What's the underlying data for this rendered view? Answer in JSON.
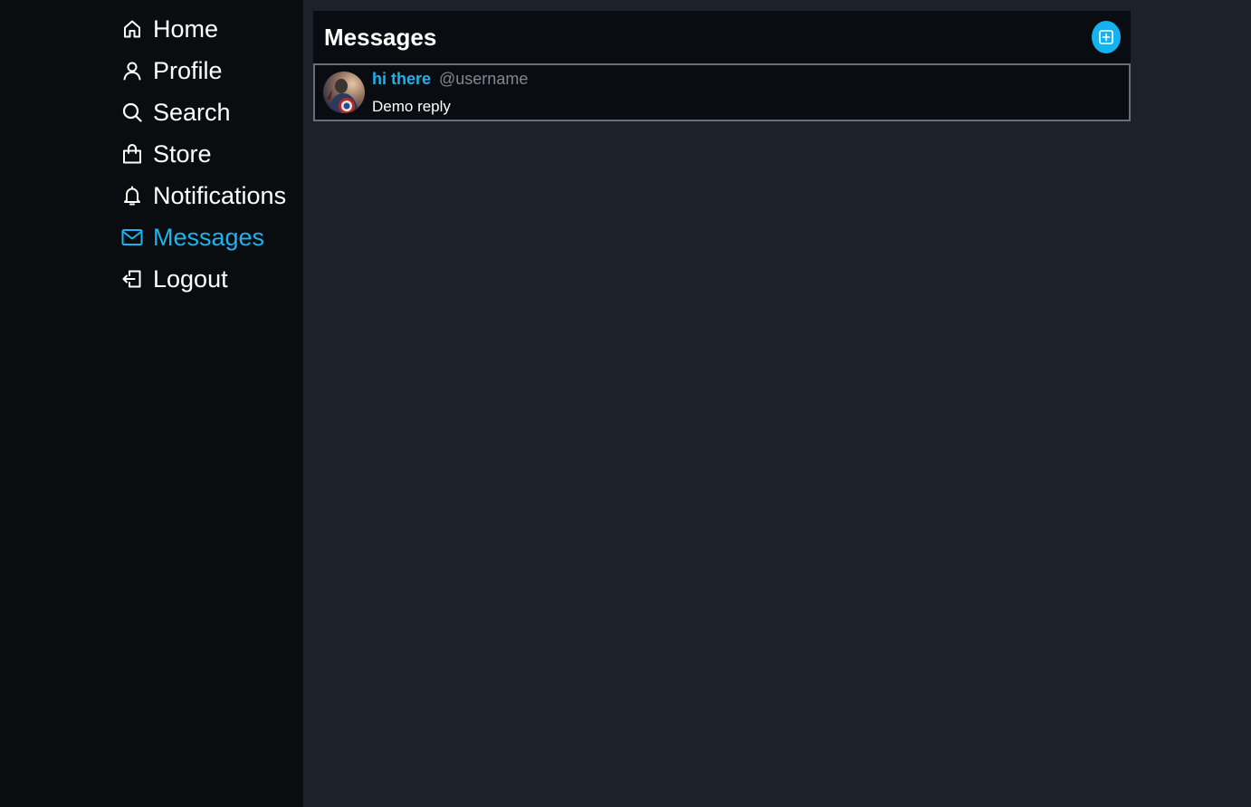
{
  "sidebar": {
    "items": [
      {
        "label": "Home",
        "icon": "home-icon",
        "active": false
      },
      {
        "label": "Profile",
        "icon": "user-icon",
        "active": false
      },
      {
        "label": "Search",
        "icon": "search-icon",
        "active": false
      },
      {
        "label": "Store",
        "icon": "shopping-bag-icon",
        "active": false
      },
      {
        "label": "Notifications",
        "icon": "bell-icon",
        "active": false
      },
      {
        "label": "Messages",
        "icon": "mail-icon",
        "active": true
      },
      {
        "label": "Logout",
        "icon": "logout-icon",
        "active": false
      }
    ]
  },
  "main": {
    "title": "Messages",
    "new_message_icon": "plus-square-icon",
    "messages": [
      {
        "name": "hi there",
        "handle": "@username",
        "text": "Demo reply",
        "avatar_icon": "avatar-image"
      }
    ]
  },
  "colors": {
    "accent": "#1cb3ee",
    "sidebar_bg": "#0a0d10",
    "page_bg": "#1c212a",
    "panel_bg": "#090c10",
    "text": "#ffffff",
    "muted": "#828893"
  }
}
